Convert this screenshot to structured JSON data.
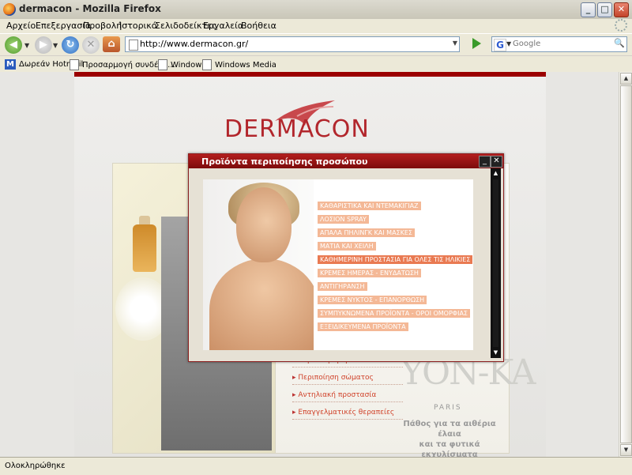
{
  "window": {
    "title": "dermacon - Mozilla Firefox",
    "controls": {
      "minimize": "_",
      "maximize": "□",
      "close": "✕"
    }
  },
  "menu": [
    "Αρχείο",
    "Επεξεργασία",
    "Προβολή",
    "Ιστορικό",
    "Σελιδοδείκτες",
    "Εργαλεία",
    "Βοήθεια"
  ],
  "nav": {
    "url": "http://www.dermacon.gr/",
    "search_placeholder": "Google",
    "search_engine_letter": "G"
  },
  "bookmarks": [
    "Δωρεάν Hotmail",
    "Προσαρμογή συνδέσε...",
    "Windows",
    "Windows Media"
  ],
  "site": {
    "logo": "DERMACON",
    "side_menu": [
      "Περιποίηση προσώπου",
      "Περιποίηση σώματος",
      "Αντηλιακή προστασία",
      "Επαγγελματικές θεραπείες"
    ],
    "brand": "YON-KA",
    "brand_city": "PARIS",
    "tagline_1": "Πάθος για τα αιθέρια έλαια",
    "tagline_2": "και τα φυτικά εκχυλίσματα"
  },
  "popup": {
    "title": "Προϊόντα περιποίησης προσώπου",
    "minimize": "_",
    "close": "✕",
    "items": [
      {
        "label": "ΚΑΘΑΡΙΣΤΙΚΑ ΚΑΙ ΝΤΕΜΑΚΙΓΙΑΖ",
        "highlight": false
      },
      {
        "label": "ΛΟΣΙΟΝ SPRAY",
        "highlight": false
      },
      {
        "label": "ΑΠΑΛΑ ΠΗΛΙΝΓΚ ΚΑΙ ΜΑΣΚΕΣ",
        "highlight": false
      },
      {
        "label": "ΜΑΤΙΑ ΚΑΙ ΧΕΙΛΗ",
        "highlight": false
      },
      {
        "label": "ΚΑΘΗΜΕΡΙΝΗ ΠΡΟΣΤΑΣΙΑ ΓΙΑ ΟΛΕΣ ΤΙΣ ΗΛΙΚΙΕΣ",
        "highlight": true
      },
      {
        "label": "ΚΡΕΜΕΣ ΗΜΕΡΑΣ - ΕΝΥΔΑΤΩΣΗ",
        "highlight": false
      },
      {
        "label": "ΑΝΤΙΓΗΡΑΝΣΗ",
        "highlight": false
      },
      {
        "label": "ΚΡΕΜΕΣ ΝΥΚΤΟΣ - ΕΠΑΝΟΡΘΩΣΗ",
        "highlight": false
      },
      {
        "label": "ΣΥΜΠΥΚΝΩΜΕΝΑ ΠΡΟΪΟΝΤΑ - ΟΡΟΙ ΟΜΟΡΦΙΑΣ",
        "highlight": false
      },
      {
        "label": "ΕΞΕΙΔΙΚΕΥΜΕΝΑ ΠΡΟΪΟΝΤΑ",
        "highlight": false
      }
    ]
  },
  "status": "Ολοκληρώθηκε",
  "colors": {
    "brand_red": "#b2262c",
    "popup_title": "#9b1010",
    "item_bg": "#f4b896",
    "item_highlight": "#e97a52"
  }
}
